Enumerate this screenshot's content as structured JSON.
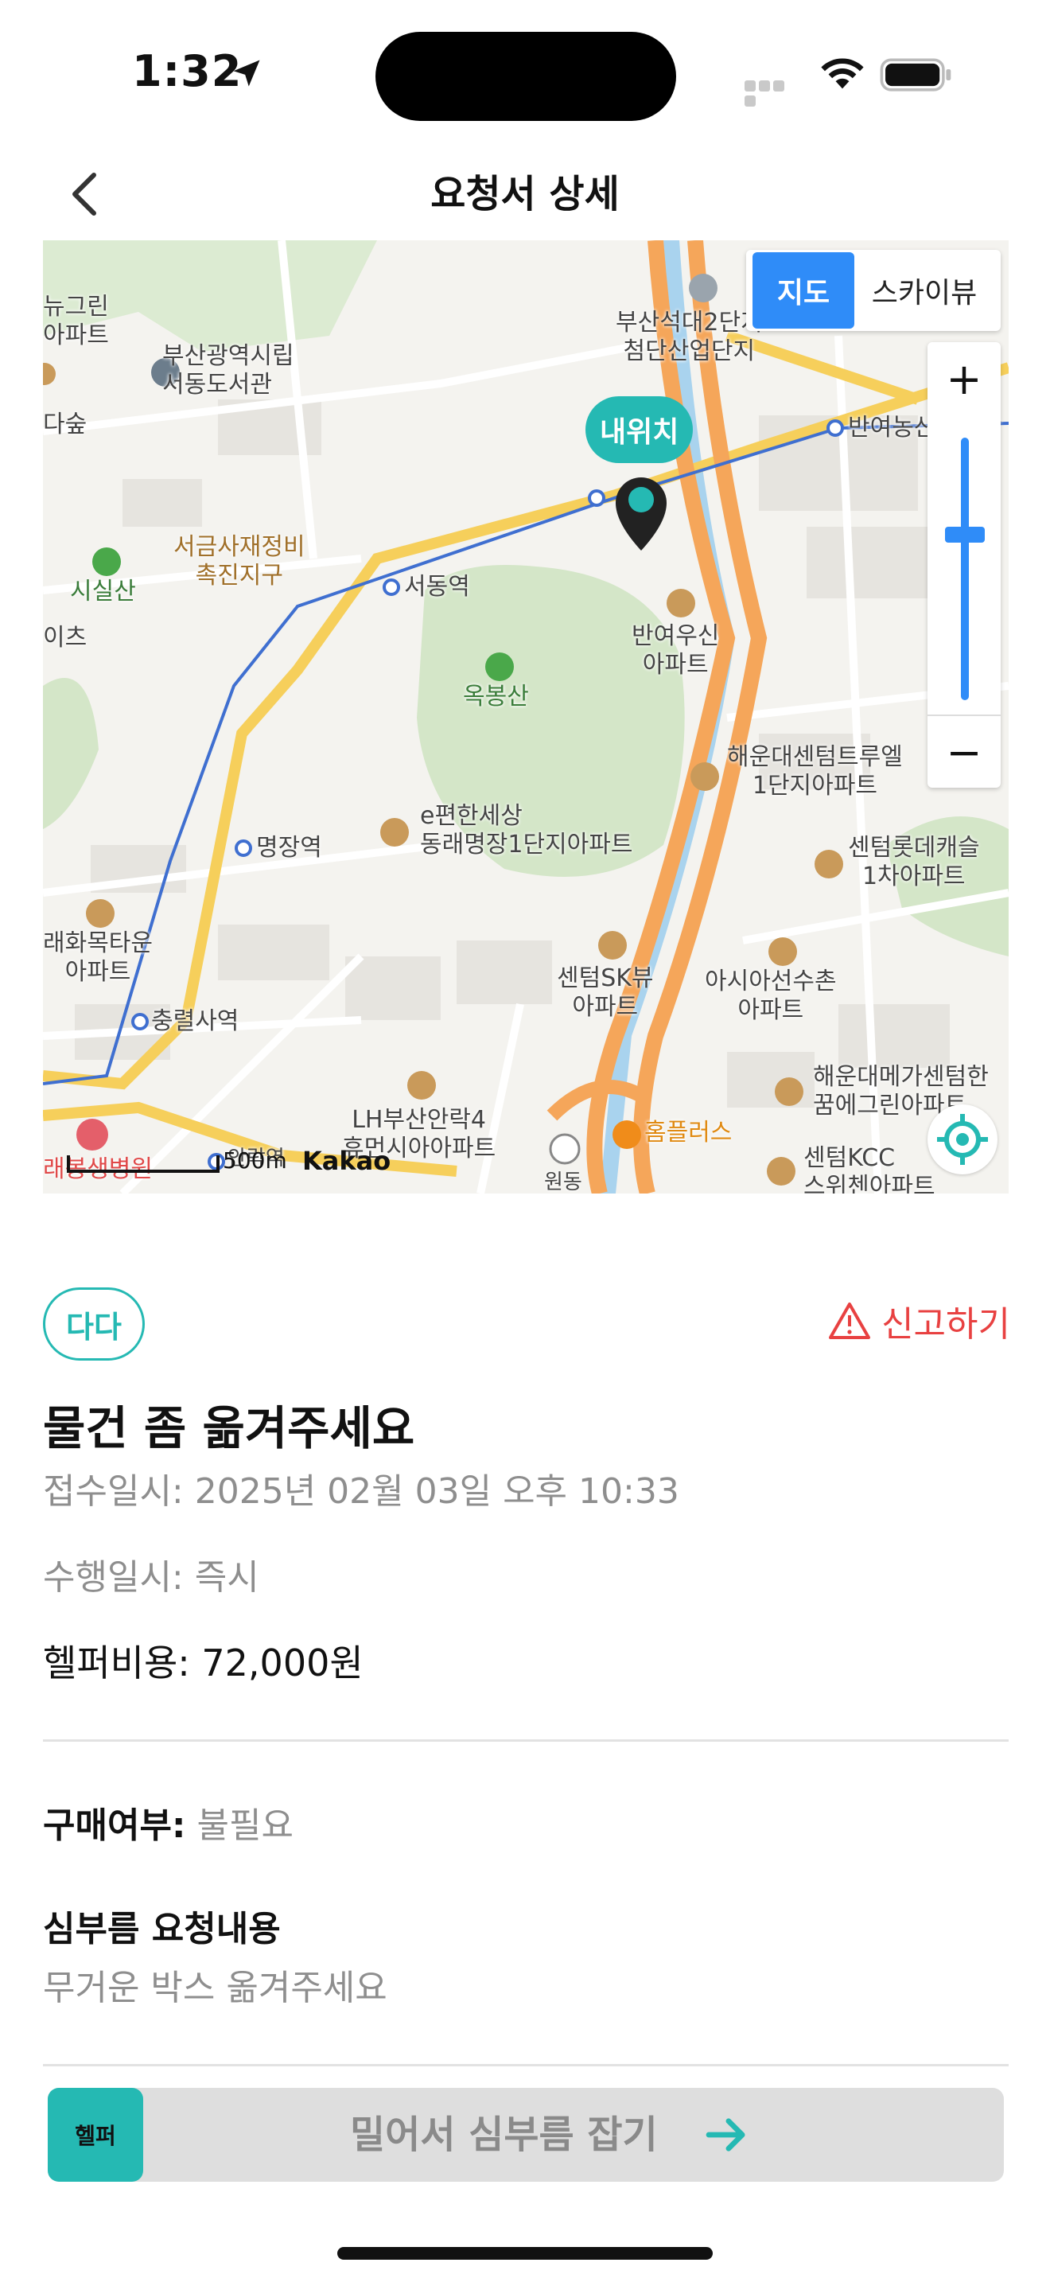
{
  "status_bar": {
    "time": "1:32"
  },
  "nav": {
    "title": "요청서 상세"
  },
  "map": {
    "toggle_map": "지도",
    "toggle_skyview": "스카이뷰",
    "zoom_in": "+",
    "zoom_out": "−",
    "my_location_bubble": "내위치",
    "scale_label": "500m",
    "attribution": "Kakao",
    "labels": {
      "library": "부산광역시립\n서동도서관",
      "reform": "서금사재정비\n촉진지구",
      "seodong": "서동역",
      "okbongsan": "옥봉산",
      "myeongjang": "명장역",
      "eapt": "e편한세상\n동래명장1단지아파트",
      "banyeo_apt": "반여우신\n아파트",
      "haeundae1": "해운대센텀트루엘\n1단지아파트",
      "lotte": "센텀롯데캐슬\n1차아파트",
      "raehwa": "래화목타운\n아파트",
      "chungryeolsa": "충렬사역",
      "sk": "센텀SK뷰\n아파트",
      "asia": "아시아선수촌\n아파트",
      "lh": "LH부산안락4\n휴먼시아아파트",
      "homeplus": "홈플러스",
      "megacenter": "해운대메가센텀한\n꿈에그린아파트",
      "kcc": "센텀KCC\n스위첸아파트",
      "banyeo_station": "반여농산물시장",
      "hightech": "부산석대2단지\n첨단산업단지",
      "sisilsan": "시실산",
      "won_dong": "원동",
      "green_apt": "뉴그린\n아파트",
      "forest": "다숲",
      "eis": "이츠",
      "hospital": "래봉생병원",
      "anrak": "안락역"
    }
  },
  "detail": {
    "badge": "다다",
    "report": "신고하기",
    "title": "물건 좀 옮겨주세요",
    "received": "접수일시: 2025년 02월 03일 오후 10:33",
    "perform": "수행일시: 즉시",
    "fee": "헬퍼비용: 72,000원",
    "purchase_label": "구매여부:",
    "purchase_value": " 불필요",
    "errand_label": "심부름 요청내용",
    "errand_value": "무거운 박스 옮겨주세요"
  },
  "action": {
    "logo": "헬퍼",
    "label": "밀어서 심부름 잡기"
  },
  "colors": {
    "accent": "#25b9b3",
    "blue": "#2f8cf8",
    "danger": "#e84141"
  }
}
